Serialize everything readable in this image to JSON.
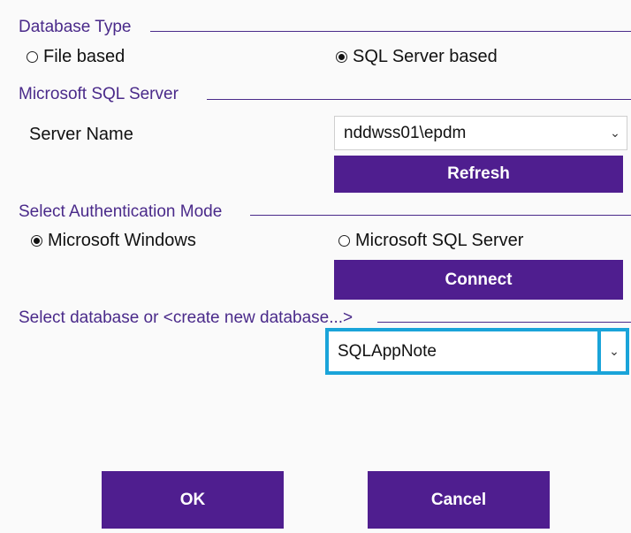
{
  "database_type": {
    "title": "Database Type",
    "options": [
      {
        "label": "File based",
        "checked": false
      },
      {
        "label": "SQL Server based",
        "checked": true
      }
    ]
  },
  "sql_server": {
    "title": "Microsoft SQL Server",
    "server_name_label": "Server Name",
    "server_name_value": "nddwss01\\epdm",
    "refresh_label": "Refresh"
  },
  "auth": {
    "title": "Select Authentication Mode",
    "options": [
      {
        "label": "Microsoft Windows",
        "checked": true
      },
      {
        "label": "Microsoft SQL Server",
        "checked": false
      }
    ],
    "connect_label": "Connect"
  },
  "database": {
    "title": "Select database or <create new database...>",
    "selected_value": "SQLAppNote"
  },
  "footer": {
    "ok_label": "OK",
    "cancel_label": "Cancel"
  },
  "icons": {
    "chevron": "chevron-down-icon"
  },
  "colors": {
    "accent": "#4f1e8f",
    "section_text": "#4a2a8a",
    "highlight": "#1aa4d9"
  }
}
